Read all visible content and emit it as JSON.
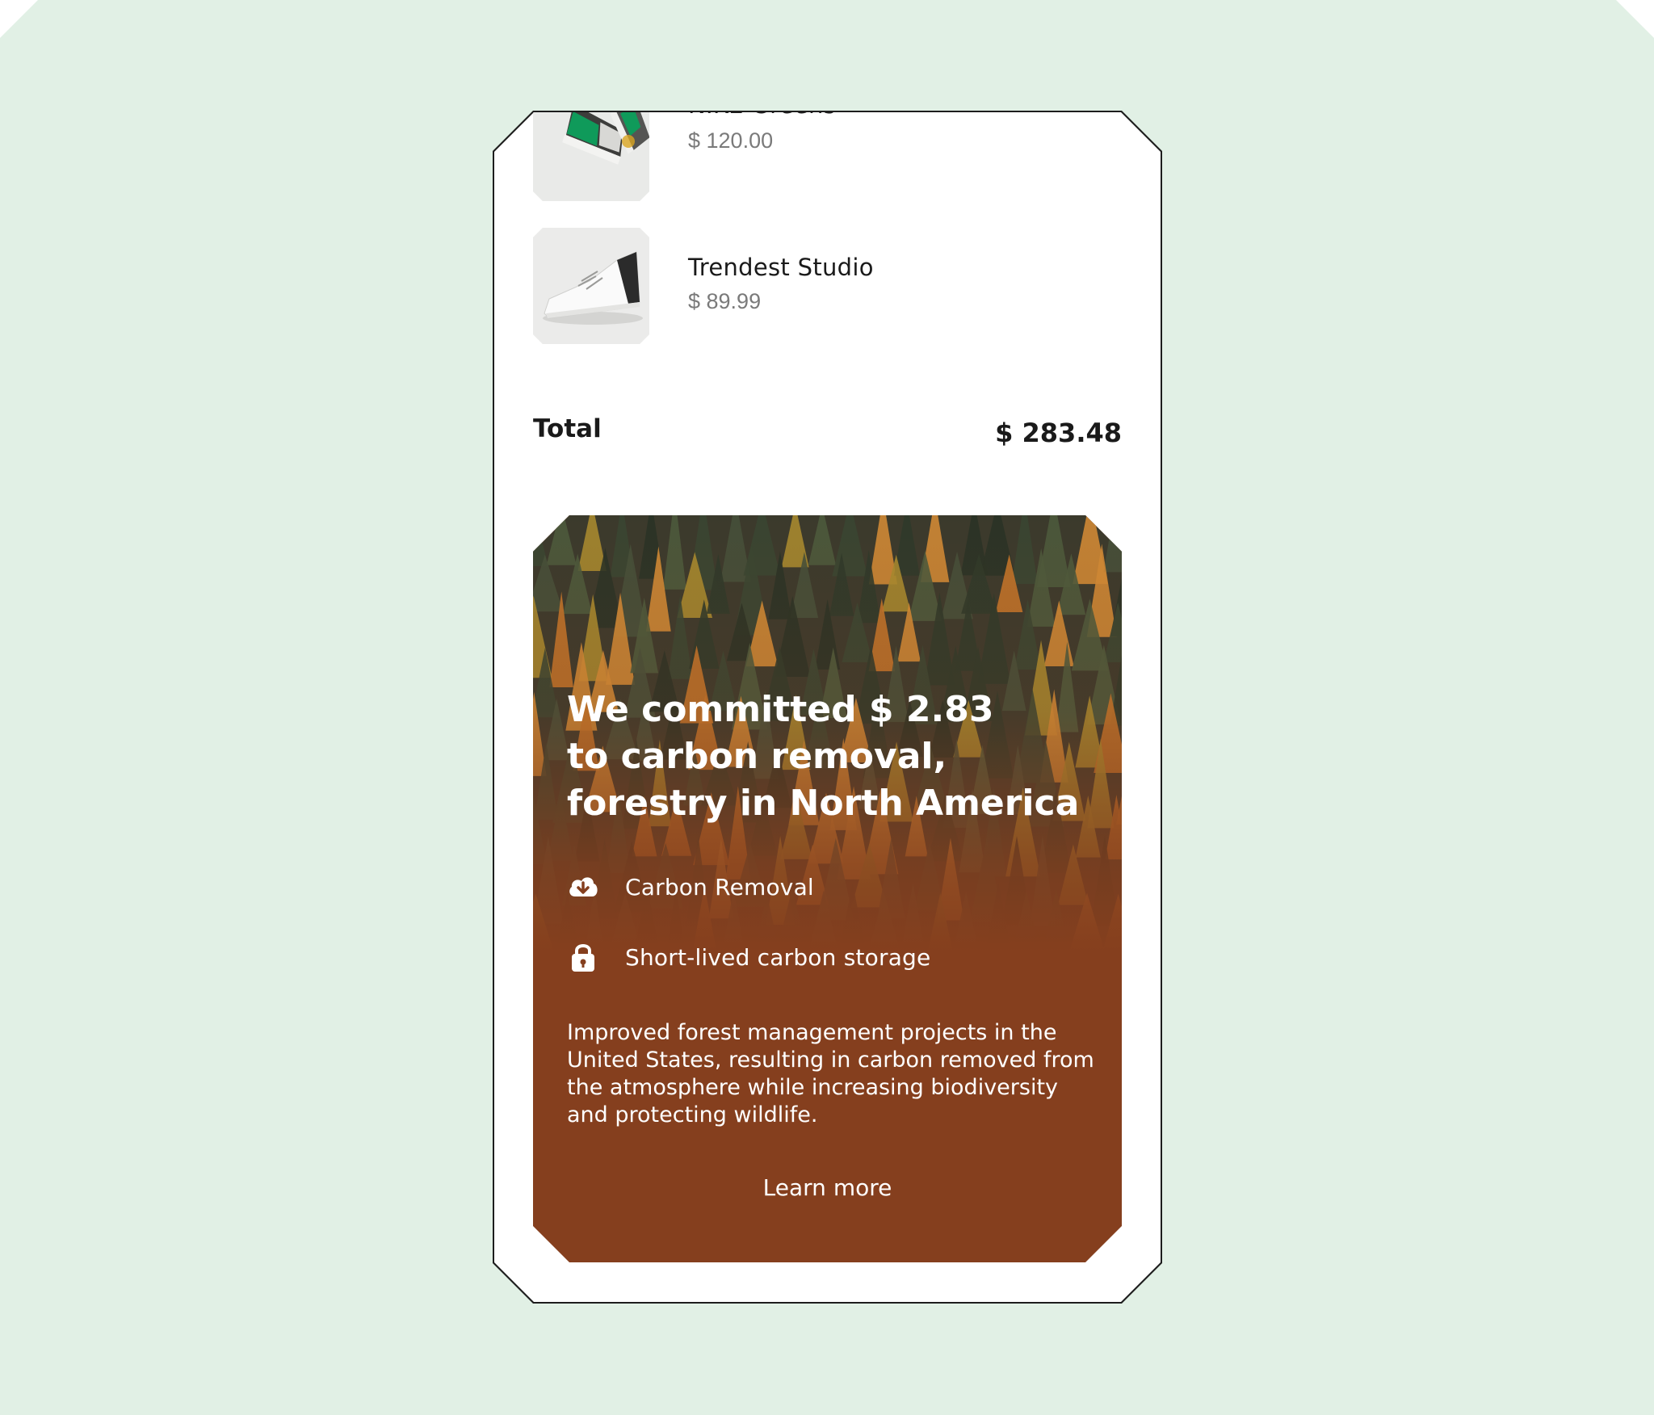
{
  "cart": {
    "items": [
      {
        "name": "NIKE Greens",
        "price": "$ 120.00",
        "image": "green-sneaker-image"
      },
      {
        "name": "Trendest Studio",
        "price": "$ 89.99",
        "image": "white-sneaker-image"
      }
    ],
    "total_label": "Total",
    "total_value": "$ 283.48"
  },
  "promo": {
    "headline": "We committed $ 2.83\nto carbon removal,\nforestry in North America",
    "features": [
      {
        "icon": "cloud-download-icon",
        "label": "Carbon Removal"
      },
      {
        "icon": "lock-icon",
        "label": "Short-lived carbon storage"
      }
    ],
    "description": "Improved forest management projects in the United States, resulting in carbon removed from the atmosphere while increasing biodiversity and protecting wildlife.",
    "cta_label": "Learn more"
  },
  "colors": {
    "page_background": "#e1f0e5",
    "promo_background": "#853f1e",
    "price_text": "#7a7a7a"
  }
}
